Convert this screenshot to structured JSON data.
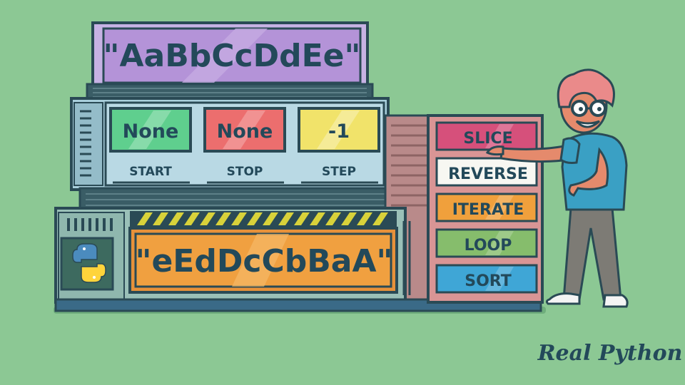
{
  "top_display": {
    "text": "\"AaBbCcDdEe\""
  },
  "slice_params": [
    {
      "value": "None",
      "label": "START",
      "color": "#5fcf8e"
    },
    {
      "value": "None",
      "label": "STOP",
      "color": "#ec6e6e"
    },
    {
      "value": "-1",
      "label": "STEP",
      "color": "#f1e36a"
    }
  ],
  "result_display": {
    "text": "\"eEdDcCbBaA\""
  },
  "operations": [
    {
      "label": "SLICE",
      "color": "#d6507b"
    },
    {
      "label": "REVERSE",
      "color": "#f7f7f2"
    },
    {
      "label": "ITERATE",
      "color": "#f0a03c"
    },
    {
      "label": "LOOP",
      "color": "#86bd6c"
    },
    {
      "label": "SORT",
      "color": "#3fa6d6"
    }
  ],
  "brand": {
    "logo_text": "Real Python"
  },
  "icons": {
    "python_logo": "python-logo-icon"
  },
  "colors": {
    "background": "#8cc894",
    "outline": "#2a4a55",
    "top_panel": "#b99ad8",
    "machine_body": "#a7ccd8",
    "result_panel": "#f0a040",
    "hazard_yellow": "#e0d43a"
  }
}
